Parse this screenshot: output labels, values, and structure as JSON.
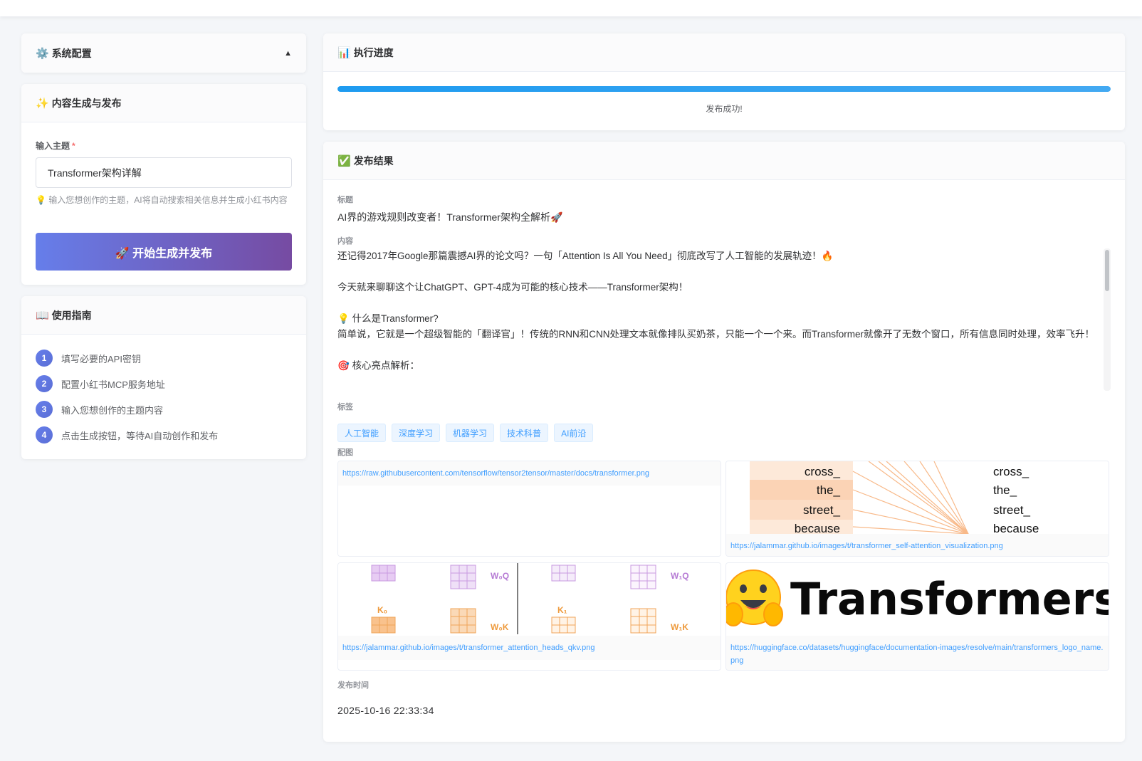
{
  "config_panel": {
    "icon": "gear-icon",
    "title": "系统配置",
    "toggle_icon": "caret-up-icon"
  },
  "generate_panel": {
    "icon": "sparkles-icon",
    "title": "内容生成与发布",
    "topic_label": "输入主题",
    "required_mark": "*",
    "topic_value": "Transformer架构详解",
    "hint": "💡 输入您想创作的主题，AI将自动搜索相关信息并生成小红书内容",
    "button_label": "🚀 开始生成并发布"
  },
  "guide_panel": {
    "icon": "book-icon",
    "title": "使用指南",
    "steps": [
      {
        "num": "1",
        "text": "填写必要的API密钥"
      },
      {
        "num": "2",
        "text": "配置小红书MCP服务地址"
      },
      {
        "num": "3",
        "text": "输入您想创作的主题内容"
      },
      {
        "num": "4",
        "text": "点击生成按钮，等待AI自动创作和发布"
      }
    ]
  },
  "progress_panel": {
    "icon": "bar-chart-icon",
    "title": "执行进度",
    "percent": 100,
    "status_text": "发布成功!"
  },
  "result_panel": {
    "icon": "check-mark-icon",
    "title": "发布结果",
    "title_label": "标题",
    "post_title": "AI界的游戏规则改变者！Transformer架构全解析🚀",
    "content_label": "内容",
    "content_lines": [
      "还记得2017年Google那篇震撼AI界的论文吗？一句「Attention Is All You Need」彻底改写了人工智能的发展轨迹！🔥",
      "",
      "今天就来聊聊这个让ChatGPT、GPT-4成为可能的核心技术——Transformer架构！",
      "",
      "💡 什么是Transformer?",
      "简单说，它就是一个超级智能的「翻译官」！传统的RNN和CNN处理文本就像排队买奶茶，只能一个一个来。而Transformer就像开了无数个窗口，所有信息同时处理，效率飞升！",
      "",
      "🎯 核心亮点解析："
    ],
    "tags_label": "标签",
    "tags": [
      "人工智能",
      "深度学习",
      "机器学习",
      "技术科普",
      "AI前沿"
    ],
    "images_label": "配图",
    "images": [
      {
        "url": "https://raw.githubusercontent.com/tensorflow/tensor2tensor/master/docs/transformer.png"
      },
      {
        "url": "https://jalammar.github.io/images/t/transformer_self-attention_visualization.png",
        "words": [
          "cross_",
          "the_",
          "street_",
          "because"
        ]
      },
      {
        "url": "https://jalammar.github.io/images/t/transformer_attention_heads_qkv.png",
        "labels": [
          "W₀Q",
          "W₀K",
          "K₀",
          "W₁Q",
          "W₁K",
          "K₁"
        ]
      },
      {
        "url": "https://huggingface.co/datasets/huggingface/documentation-images/resolve/main/transformers_logo_name.png",
        "logo_text": "Transformers"
      }
    ],
    "time_label": "发布时间",
    "publish_time": "2025-10-16 22:33:34"
  },
  "colors": {
    "accent_gradient_start": "#667eea",
    "accent_gradient_end": "#764ba2",
    "progress": "#1e9bf0",
    "tag": "#409eff",
    "required": "#f56c6c"
  }
}
